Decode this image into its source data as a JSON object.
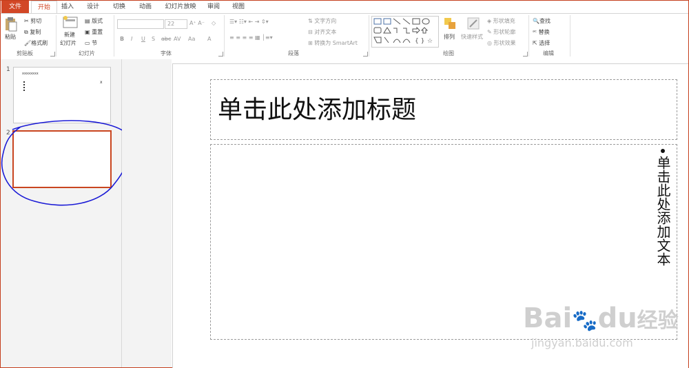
{
  "tabs": [
    "文件",
    "开始",
    "插入",
    "设计",
    "切换",
    "动画",
    "幻灯片放映",
    "审阅",
    "视图"
  ],
  "clipboard": {
    "paste": "粘贴",
    "cut": "剪切",
    "copy": "复制",
    "format_painter": "格式刷",
    "group": "剪贴板"
  },
  "slides_group": {
    "new_slide": "新建",
    "new_slide2": "幻灯片",
    "layout": "版式",
    "reset": "重置",
    "section": "节",
    "group": "幻灯片"
  },
  "font": {
    "font_size": "22",
    "bold": "B",
    "italic": "I",
    "underline": "U",
    "shadow": "S",
    "strike": "abc",
    "spacing": "AV",
    "case": "Aa",
    "group": "字体"
  },
  "paragraph": {
    "text_direction": "文字方向",
    "align_text": "对齐文本",
    "smartart": "转换为 SmartArt",
    "group": "段落"
  },
  "drawing": {
    "arrange": "排列",
    "quick_styles": "快速样式",
    "shape_fill": "形状填充",
    "shape_outline": "形状轮廓",
    "shape_effects": "形状效果",
    "group": "绘图"
  },
  "editing": {
    "find": "查找",
    "replace": "替换",
    "select": "选择",
    "group": "编辑"
  },
  "thumbnails": [
    {
      "num": "1",
      "title_mark": "хххххххх",
      "side_mark": "x"
    },
    {
      "num": "2"
    }
  ],
  "slide": {
    "title_placeholder": "单击此处添加标题",
    "body_placeholder": "单击此处添加文本"
  },
  "watermark": {
    "brand": "Bai",
    "brand2": "du",
    "brand3": "经验",
    "url": "jingyan.baidu.com"
  },
  "colors": {
    "accent": "#d24726",
    "selection": "#c9451f",
    "annotation": "#1a1ad6"
  }
}
